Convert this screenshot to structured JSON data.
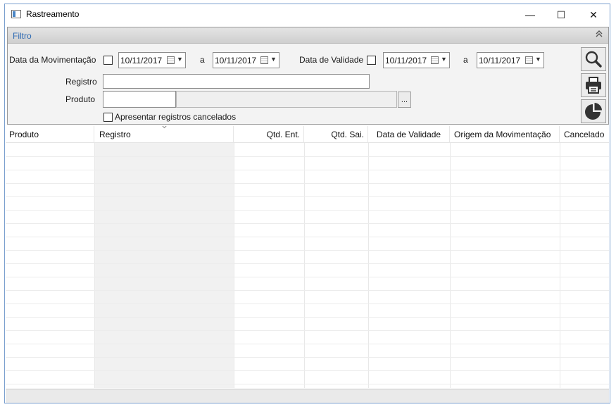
{
  "window": {
    "title": "Rastreamento",
    "minimize_glyph": "—",
    "maximize_glyph": "☐",
    "close_glyph": "✕"
  },
  "filter": {
    "title": "Filtro",
    "collapse_glyph": "≈",
    "movement_date": {
      "label": "Data da Movimentação",
      "checked": false,
      "from": "10/11/2017",
      "separator": "a",
      "to": "10/11/2017"
    },
    "expiry_date": {
      "label": "Data de Validade",
      "checked": false,
      "from": "10/11/2017",
      "separator": "a",
      "to": "10/11/2017"
    },
    "registro": {
      "label": "Registro",
      "value": ""
    },
    "produto": {
      "label": "Produto",
      "code": "",
      "description": "",
      "lookup_label": "..."
    },
    "show_cancelled": {
      "label": "Apresentar registros cancelados",
      "checked": false
    }
  },
  "actions": {
    "search_icon": "search-icon",
    "print_icon": "printer-icon",
    "chart_icon": "pie-chart-icon"
  },
  "grid": {
    "columns": [
      "Produto",
      "Registro",
      "Qtd. Ent.",
      "Qtd. Sai.",
      "Data de Validade",
      "Origem da Movimentação",
      "Cancelado"
    ],
    "sorted_column": "Registro",
    "rows": []
  },
  "colors": {
    "accent": "#2d6ab3",
    "window_border": "#7a9fcf"
  }
}
